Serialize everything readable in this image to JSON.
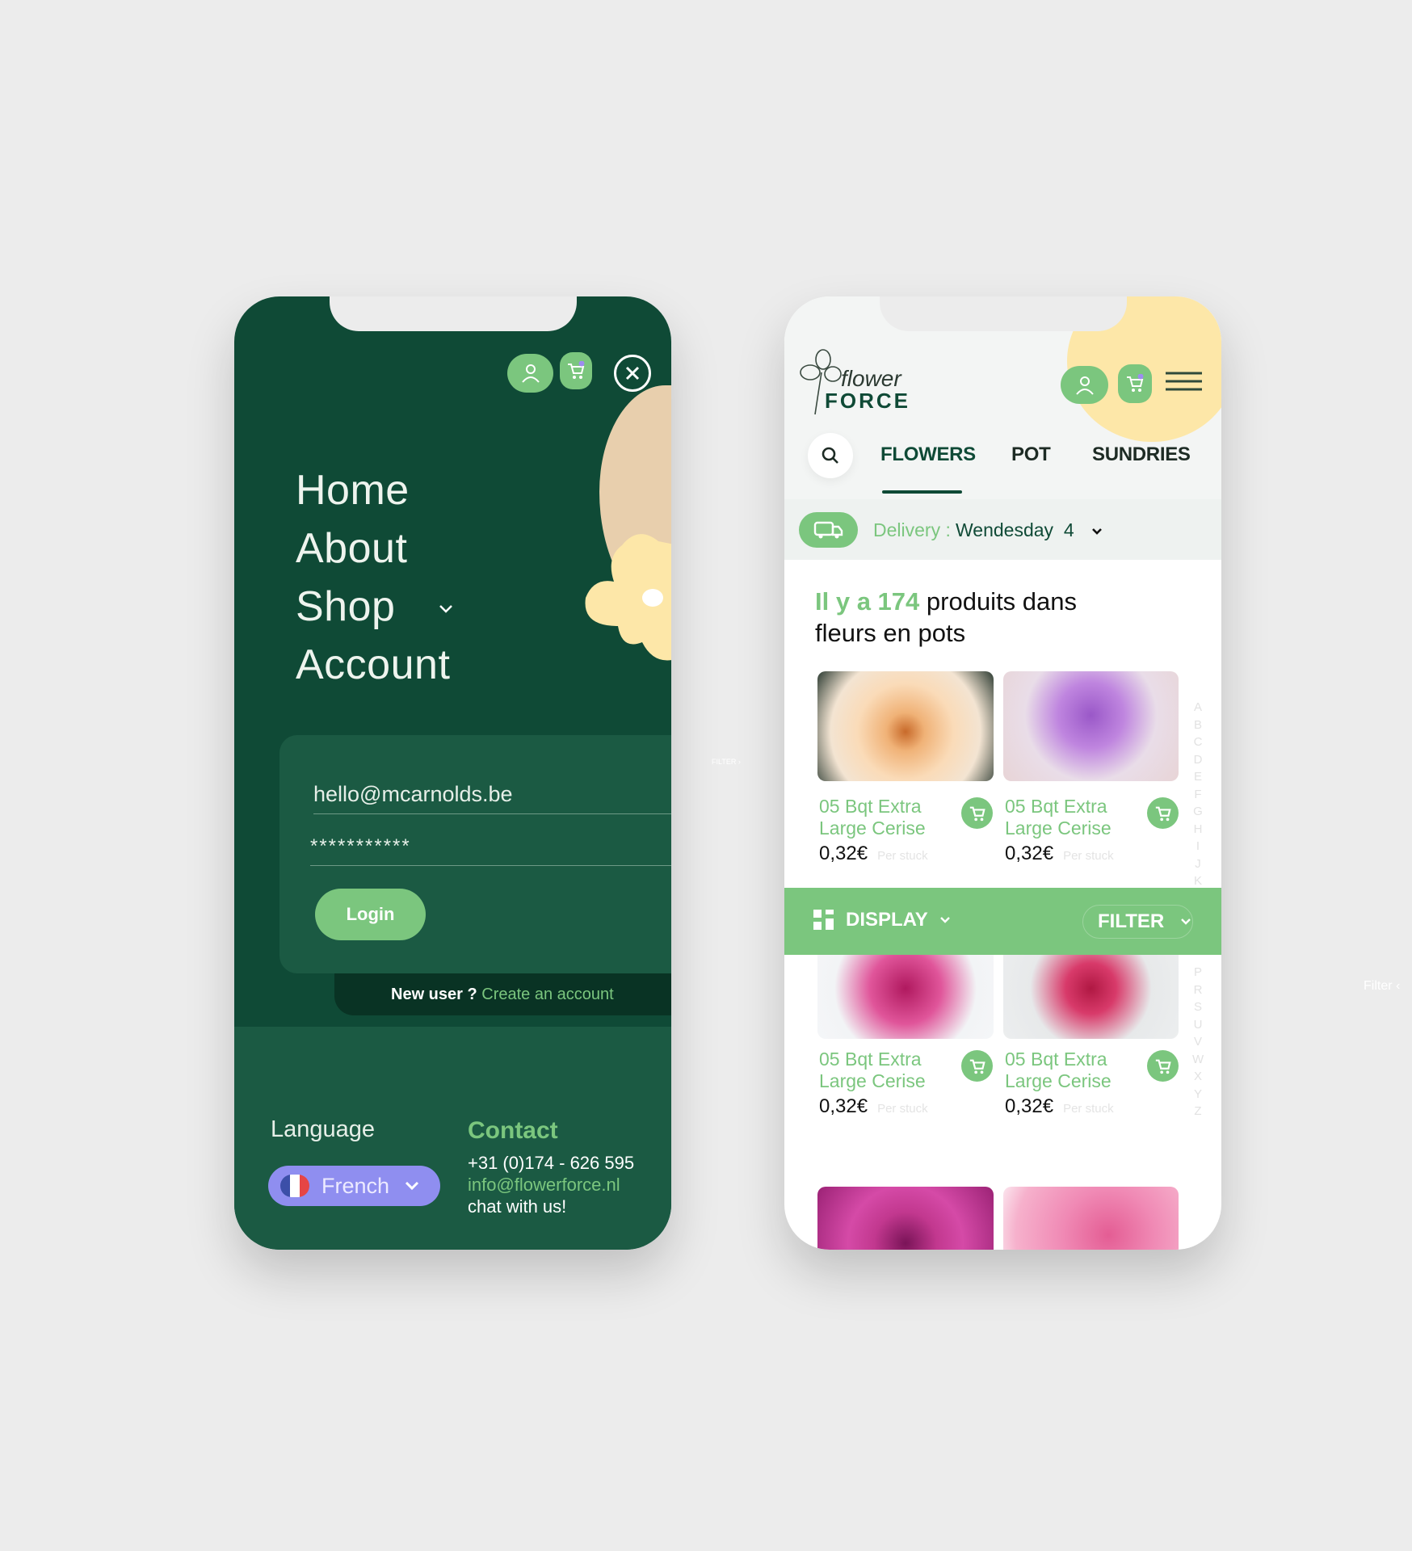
{
  "left_phone": {
    "header": {
      "user_icon": "user-icon",
      "cart_icon": "cart-icon",
      "close_icon": "close-icon"
    },
    "menu": [
      {
        "label": "Home"
      },
      {
        "label": "About"
      },
      {
        "label": "Shop",
        "has_dropdown": true
      },
      {
        "label": "Account"
      }
    ],
    "login": {
      "email_value": "hello@mcarnolds.be",
      "password_value": "***********",
      "login_button": "Login",
      "new_user_text": "New user ?",
      "create_account_link": "Create an account"
    },
    "footer": {
      "language_label": "Language",
      "language_selected": "French",
      "contact_title": "Contact",
      "phone": "+31 (0)174 - 626 595",
      "email": "info@flowerforce.nl",
      "chat": "chat with us!"
    }
  },
  "right_phone": {
    "logo": {
      "line1": "flower",
      "line2": "FORCE"
    },
    "tabs": [
      {
        "label": "FLOWERS",
        "active": true
      },
      {
        "label": "POT",
        "active": false
      },
      {
        "label": "SUNDRIES",
        "active": false
      }
    ],
    "delivery": {
      "label": "Delivery :",
      "value": "Wendesday  4"
    },
    "heading": {
      "highlight": "Il y a 174",
      "rest_line1": " produits dans",
      "line2": "fleurs en pots"
    },
    "products": [
      {
        "title_line1": "05 Bqt Extra",
        "title_line2": "Large Cerise",
        "price": "0,32€",
        "unit": "Per stuck"
      },
      {
        "title_line1": "05 Bqt Extra",
        "title_line2": "Large Cerise",
        "price": "0,32€",
        "unit": "Per stuck"
      },
      {
        "title_line1": "05 Bqt Extra",
        "title_line2": "Large Cerise",
        "price": "0,32€",
        "unit": "Per stuck"
      },
      {
        "title_line1": "05 Bqt Extra",
        "title_line2": "Large Cerise",
        "price": "0,32€",
        "unit": "Per stuck"
      }
    ],
    "alphabet_top": [
      "A",
      "B",
      "C",
      "D",
      "E",
      "F",
      "G",
      "H",
      "I",
      "J",
      "K"
    ],
    "alphabet_bottom": [
      "P",
      "R",
      "S",
      "U",
      "V",
      "W",
      "X",
      "Y",
      "Z"
    ],
    "toolbar": {
      "display_label": "DISPLAY",
      "filter_label": "FILTER"
    }
  },
  "side_labels": {
    "filter_small": "FILTER ›",
    "filter_right": "Filter ‹"
  },
  "colors": {
    "dark_green": "#0f4a36",
    "card_green": "#1b5a43",
    "accent_green": "#7bc67e",
    "beige": "#e8cfad",
    "yellow": "#fde7a8",
    "language_purple": "#8f8ef0"
  }
}
